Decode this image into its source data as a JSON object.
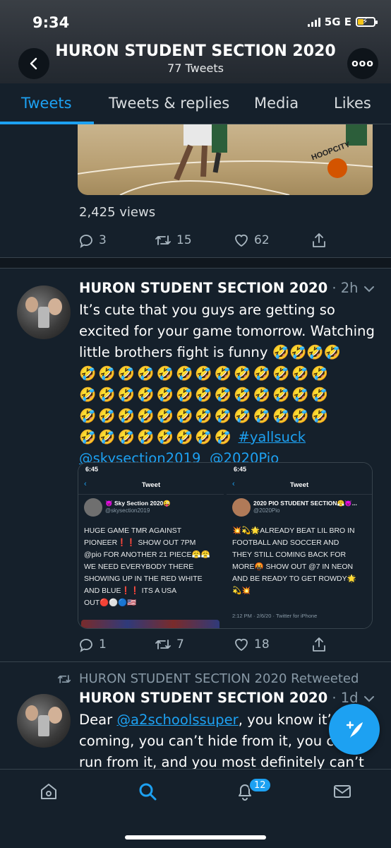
{
  "status_bar": {
    "time": "9:34",
    "network": "5G E"
  },
  "header": {
    "profile_name": "HURON STUDENT SECTION 2020",
    "tweet_count": "77 Tweets",
    "more_label": "ooo"
  },
  "tabs": [
    {
      "label": "Tweets",
      "active": true
    },
    {
      "label": "Tweets & replies",
      "active": false
    },
    {
      "label": "Media",
      "active": false
    },
    {
      "label": "Likes",
      "active": false
    }
  ],
  "top_tweet": {
    "views": "2,425 views",
    "replies": "3",
    "retweets": "15",
    "likes": "62",
    "watermark": "HOOPCITY"
  },
  "tweet1": {
    "name": "HURON STUDENT SECTION 2020",
    "time": "· 2h",
    "text_line1": "It’s cute that you guys are getting so",
    "text_line2": "excited for your game tomorrow. Watching",
    "text_line3": "little brothers fight is funny 🤣🤣🤣🤣",
    "emoji_row": "🤣🤣🤣🤣🤣🤣🤣🤣🤣🤣🤣🤣🤣",
    "emoji_row_short": "🤣🤣🤣🤣🤣🤣🤣🤣",
    "hashtag": "#yallsuck",
    "mention1": "@skysection2019",
    "mention2": "@2020Pio",
    "replies": "1",
    "retweets": "7",
    "likes": "18",
    "embed_left": {
      "time": "6:45",
      "title": "Tweet",
      "name": "😈 Sky Section 2020😜",
      "handle": "@skysection2019",
      "line1": "HUGE GAME TMR AGAINST",
      "line2": "PIONEER❗️❗️ SHOW OUT 7PM",
      "line3": "@pio FOR ANOTHER 21 PIECE😤😤",
      "line4": "WE NEED EVERYBODY THERE",
      "line5": "SHOWING UP IN THE RED WHITE",
      "line6": "AND BLUE❗️❗️ ITS A USA",
      "line7": "OUT🔴⚪🔵🇺🇸"
    },
    "embed_right": {
      "time": "6:45",
      "title": "Tweet",
      "name": "2020 PIO STUDENT SECTION😤😈...",
      "handle": "@2020Pio",
      "line1": "💥💫🌟ALREADY BEAT LIL BRO IN",
      "line2": "FOOTBALL AND SOCCER AND",
      "line3": "THEY STILL COMING BACK FOR",
      "line4": "MORE🤬 SHOW OUT @7 IN NEON",
      "line5": "AND BE READY TO GET ROWDY🌟",
      "line6": "💫💥",
      "meta": "2:12 PM · 2/6/20 · Twitter for iPhone"
    }
  },
  "tweet2": {
    "retweet_label": "HURON STUDENT SECTION 2020 Retweeted",
    "name": "HURON STUDENT SECTION 2020",
    "time": "· 1d",
    "text_pre": "Dear ",
    "mention": "@a2schoolssuper",
    "text_post": ", you know it’s",
    "line2": "coming, you can’t hide from it, you can’t",
    "line3": "run from it, and you most definitely can’t"
  },
  "bottom_nav": {
    "notification_count": "12"
  },
  "colors": {
    "accent": "#1da1f2",
    "background": "#15202b",
    "muted": "#8899a6"
  }
}
